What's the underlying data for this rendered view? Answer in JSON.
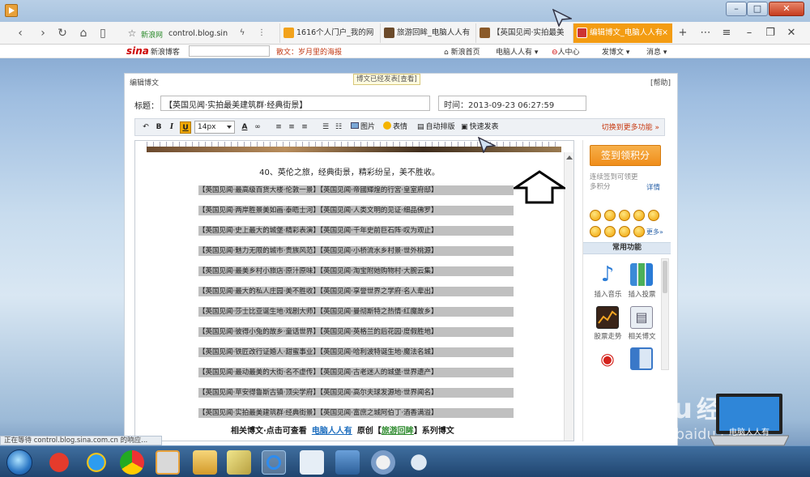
{
  "browser": {
    "address": "control.blog.sin",
    "tabs": [
      {
        "label": "新浪网"
      },
      {
        "label": "1616个人门户_我的网"
      },
      {
        "label": "旅游回眸_电脑人人有"
      },
      {
        "label": "【英国见闻·实拍最美"
      },
      {
        "label": "编辑博文_电脑人人有"
      }
    ]
  },
  "sina": {
    "logo": "sina",
    "logo_sub": "新浪博客",
    "promo": "散文：岁月里的海报",
    "nav": [
      "新浪首页",
      "电脑人人有",
      "人中心",
      "发博文",
      "消息"
    ]
  },
  "panel": {
    "title": "编辑博文",
    "help": "[帮助]",
    "title_label": "标题：",
    "title_value": "【英国见闻·实拍最美建筑群·经典街景】",
    "time": "时间：2013-09-23 06:27:59",
    "toolbar": {
      "font_size": "14px",
      "image": "图片",
      "emoticon": "表情",
      "autoformat": "自动排版",
      "quickpost": "快速发表",
      "more": "切换到更多功能"
    }
  },
  "editor": {
    "lead": "40、英伦之旅，经典街景，精彩纷呈，美不胜收。",
    "rows": [
      "【英国见闻·最高级百货大楼·伦敦一景】【英国见闻·帝國輝煌的行宮·皇室府邸】",
      "【英国见闻·两岸胜景美如画·泰晤士河】【英国见闻·人类文明的见证·细品佛罗】",
      "【英国见闻·史上最大的城堡·精彩表演】【英国见闻·千年史前巨石阵·叹为观止】",
      "【英国见闻·魅力无限的城市·贵族风范】【英国见闻·小桥流水乡村景·世外桃源】",
      "【英国见闻·最美乡村小旅店·原汁原味】【英国见闻·淘宝附她购物村·大腕云集】",
      "【英国见闻·最大的私人庄园·美不胜收】【英国见闻·享誉世界之学府·名人辈出】",
      "【英国见闻·莎士比亚诞生地·戏剧大师】【英国见闻·曼彻斯特之热情·红魔故乡】",
      "【英国见闻·彼得小兔的故乡·童话世界】【英国见闻·英格兰的后花园·度假胜地】",
      "【英国见闻·铁匠改行证婚人·甜蜜事业】【英国见闻·哈利波特诞生地·魔法名城】",
      "【英国见闻·最动最美的大街·名不虚传】【英国见闻·古老迷人的城堡·世界遗产】",
      "【英国见闻·苹安得鲁斯古镇·顶尖学府】【英国见闻·高尔夫球发源地·世界闻名】",
      "【英国见闻·实拍最美建筑群·经典街景】【英国见闻·富庶之城阿伯丁·酒香满溢】"
    ],
    "related_prefix": "相关博文·点击可查看",
    "related_link": "电脑人人有",
    "related_mid": "原创【",
    "related_link2": "旅游回眸",
    "related_suffix": "】系列博文",
    "tooltip": "博文已经发表[查看]"
  },
  "sidebar": {
    "checkin": "签到领积分",
    "checkin_tip": "连续签到可领更多积分",
    "detail": "详情",
    "emo_more": "更多»",
    "common": "常用功能",
    "functions": [
      "插入音乐",
      "插入投票",
      "股票走势",
      "相关博文"
    ]
  },
  "status": "正在等待 control.blog.sina.com.cn 的响应...",
  "watermark": {
    "logo": "Bai  du",
    "logo2": "经验",
    "url": "jingyan.baidu.com",
    "laptop_text": "电脑人人有"
  }
}
